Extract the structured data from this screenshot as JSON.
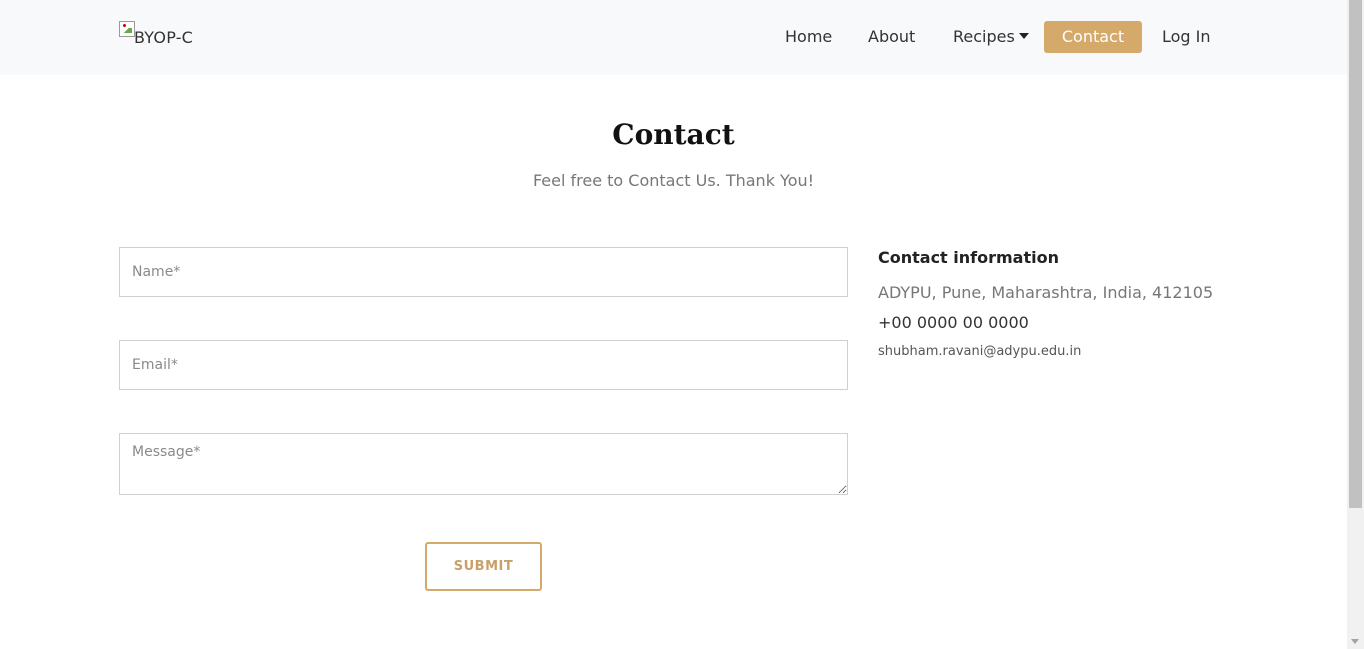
{
  "navbar": {
    "brand_alt": "BYOP-C",
    "links": {
      "home": "Home",
      "about": "About",
      "recipes": "Recipes",
      "contact": "Contact",
      "login": "Log In"
    },
    "active": "contact"
  },
  "header": {
    "title": "Contact",
    "subtitle": "Feel free to Contact Us. Thank You!"
  },
  "form": {
    "name_placeholder": "Name*",
    "email_placeholder": "Email*",
    "message_placeholder": "Message*",
    "submit_label": "SUBMIT"
  },
  "contact_info": {
    "title": "Contact information",
    "address": "ADYPU, Pune, Maharashtra, India, 412105",
    "phone": "+00 0000 00 0000",
    "email": "shubham.ravani@adypu.edu.in"
  },
  "colors": {
    "accent": "#d4a96a",
    "navbar_bg": "#f8f9fa"
  }
}
